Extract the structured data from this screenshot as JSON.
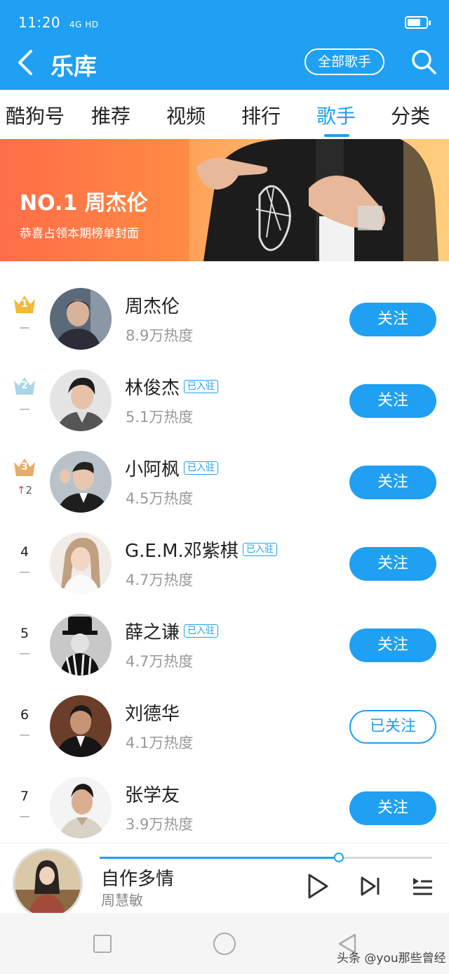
{
  "status_bar": {
    "time": "11:20",
    "signal": "4G HD"
  },
  "header": {
    "title": "乐库",
    "all_singers_label": "全部歌手"
  },
  "tabs": [
    {
      "label": "酷狗号",
      "active": false
    },
    {
      "label": "推荐",
      "active": false
    },
    {
      "label": "视频",
      "active": false
    },
    {
      "label": "排行",
      "active": false
    },
    {
      "label": "歌手",
      "active": true
    },
    {
      "label": "分类",
      "active": false
    }
  ],
  "banner": {
    "title": "NO.1 周杰伦",
    "subtitle": "恭喜占领本期榜单封面"
  },
  "singers": [
    {
      "rank": "1",
      "change": "—",
      "name": "周杰伦",
      "joined": "",
      "heat": "8.9万热度",
      "follow": "关注",
      "followed": false
    },
    {
      "rank": "2",
      "change": "—",
      "name": "林俊杰",
      "joined": "已入驻",
      "heat": "5.1万热度",
      "follow": "关注",
      "followed": false
    },
    {
      "rank": "3",
      "change": "2",
      "name": "小阿枫",
      "joined": "已入驻",
      "heat": "4.5万热度",
      "follow": "关注",
      "followed": false
    },
    {
      "rank": "4",
      "change": "—",
      "name": "G.E.M.邓紫棋",
      "joined": "已入驻",
      "heat": "4.7万热度",
      "follow": "关注",
      "followed": false
    },
    {
      "rank": "5",
      "change": "—",
      "name": "薛之谦",
      "joined": "已入驻",
      "heat": "4.7万热度",
      "follow": "关注",
      "followed": false
    },
    {
      "rank": "6",
      "change": "—",
      "name": "刘德华",
      "joined": "",
      "heat": "4.1万热度",
      "follow": "已关注",
      "followed": true
    },
    {
      "rank": "7",
      "change": "—",
      "name": "张学友",
      "joined": "",
      "heat": "3.9万热度",
      "follow": "关注",
      "followed": false
    }
  ],
  "player": {
    "song": "自作多情",
    "artist": "周慧敏",
    "progress": 0.72
  },
  "watermark": "头条 @you那些曾经",
  "colors": {
    "accent": "#1fa0f2",
    "gold": "#f5b83a",
    "silver": "#a9d6e8",
    "bronze": "#e8ab6a"
  }
}
